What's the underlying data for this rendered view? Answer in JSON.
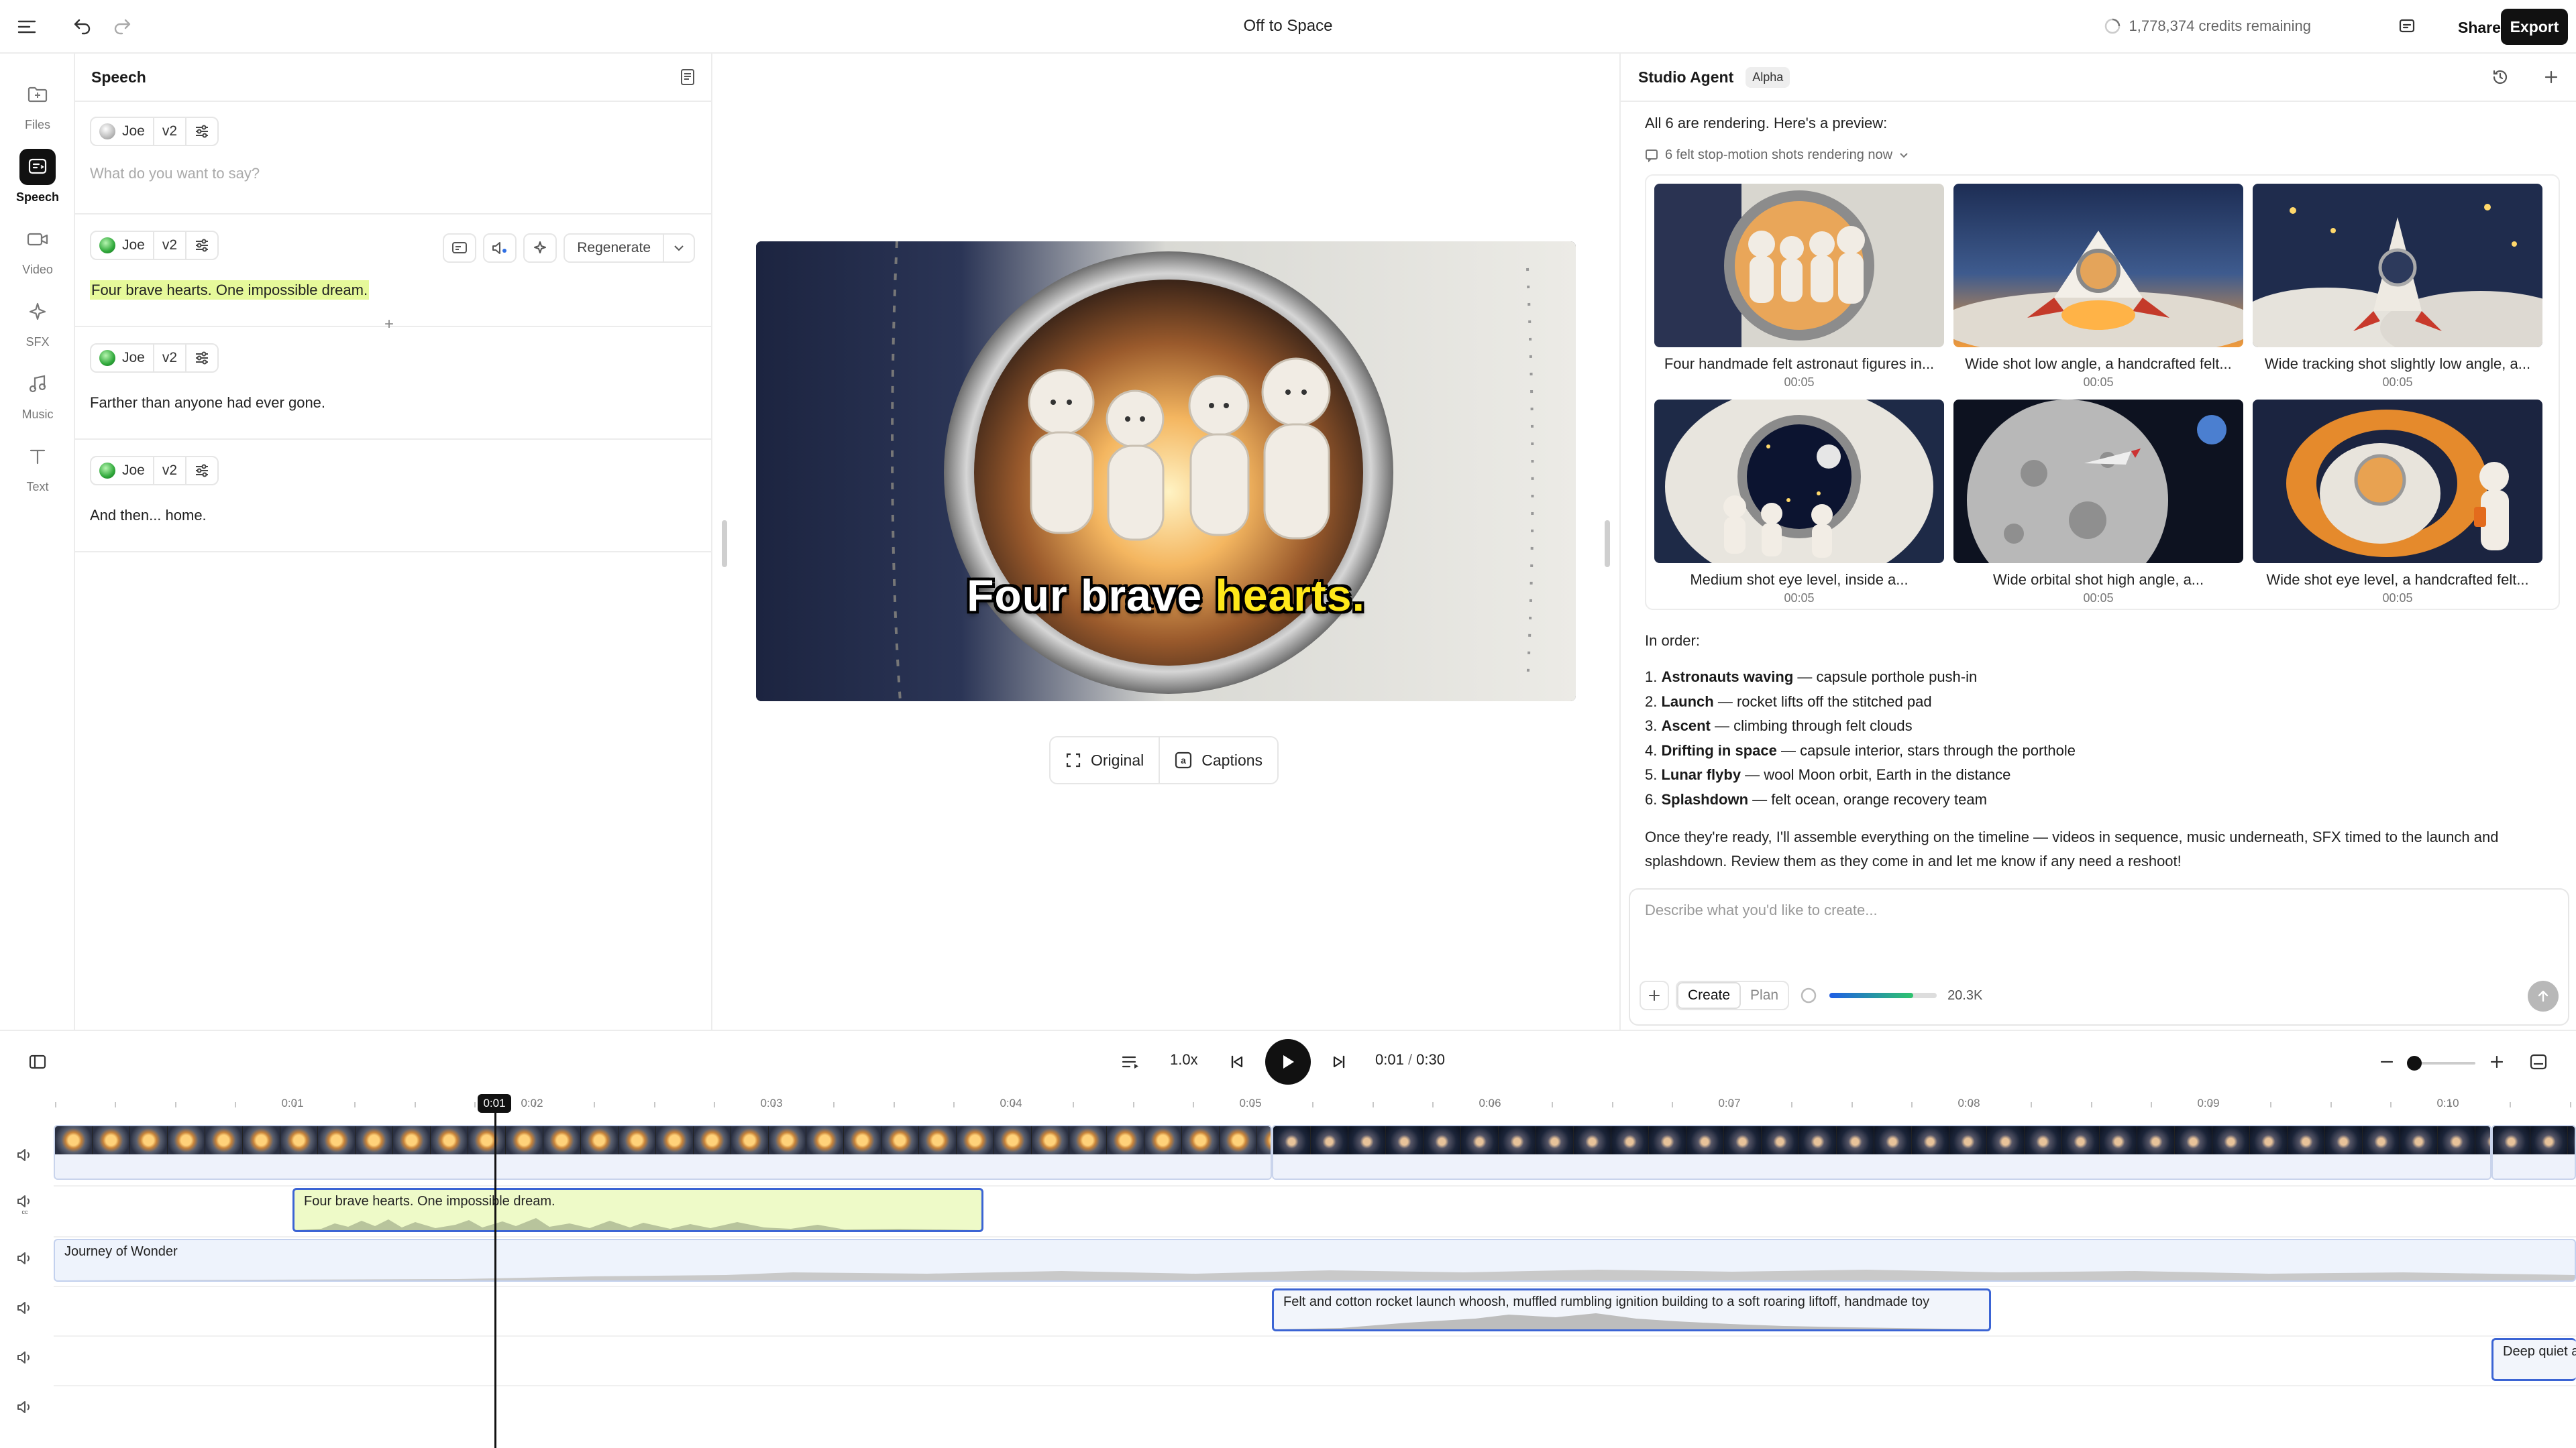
{
  "topbar": {
    "title": "Off to Space",
    "credits": "1,778,374 credits remaining",
    "share_label": "Share",
    "export_label": "Export"
  },
  "rail": {
    "items": [
      {
        "label": "Files",
        "icon": "folder-icon"
      },
      {
        "label": "Speech",
        "icon": "speech-icon",
        "active": true
      },
      {
        "label": "Video",
        "icon": "video-icon"
      },
      {
        "label": "SFX",
        "icon": "sfx-icon"
      },
      {
        "label": "Music",
        "icon": "music-icon"
      },
      {
        "label": "Text",
        "icon": "text-icon"
      }
    ]
  },
  "speech": {
    "title": "Speech",
    "segments": [
      {
        "voice": "Joe",
        "model": "v2",
        "text": "",
        "placeholder": "What do you want to say?"
      },
      {
        "voice": "Joe",
        "model": "v2",
        "text": "Four brave hearts. One impossible dream.",
        "regenerate_label": "Regenerate"
      },
      {
        "voice": "Joe",
        "model": "v2",
        "text": "Farther than anyone had ever gone."
      },
      {
        "voice": "Joe",
        "model": "v2",
        "text": "And then... home."
      }
    ]
  },
  "preview": {
    "caption_lead": "Four brave",
    "caption_highlight": "hearts.",
    "modes": [
      "Original",
      "Captions"
    ]
  },
  "agent": {
    "title": "Studio Agent",
    "badge": "Alpha",
    "intro": "All 6 are rendering. Here's a preview:",
    "status": "6 felt stop-motion shots rendering now",
    "shots": [
      {
        "title": "Four handmade felt astronaut figures in...",
        "duration": "00:05"
      },
      {
        "title": "Wide shot low angle, a handcrafted felt...",
        "duration": "00:05"
      },
      {
        "title": "Wide tracking shot slightly low angle, a...",
        "duration": "00:05"
      },
      {
        "title": "Medium shot eye level, inside a...",
        "duration": "00:05"
      },
      {
        "title": "Wide orbital shot high angle, a...",
        "duration": "00:05"
      },
      {
        "title": "Wide shot eye level, a handcrafted felt...",
        "duration": "00:05"
      }
    ],
    "order_heading": "In order:",
    "order": [
      {
        "num": "1.",
        "name": "Astronauts waving",
        "desc": " — capsule porthole push-in"
      },
      {
        "num": "2.",
        "name": "Launch",
        "desc": " — rocket lifts off the stitched pad"
      },
      {
        "num": "3.",
        "name": "Ascent",
        "desc": " — climbing through felt clouds"
      },
      {
        "num": "4.",
        "name": "Drifting in space",
        "desc": " — capsule interior, stars through the porthole"
      },
      {
        "num": "5.",
        "name": "Lunar flyby",
        "desc": " — wool Moon orbit, Earth in the distance"
      },
      {
        "num": "6.",
        "name": "Splashdown",
        "desc": " — felt ocean, orange recovery team"
      }
    ],
    "outro": "Once they're ready, I'll assemble everything on the timeline — videos in sequence, music underneath, SFX timed to the launch and splashdown. Review them as they come in and let me know if any need a reshoot!",
    "composer_placeholder": "Describe what you'd like to create...",
    "create_label": "Create",
    "plan_label": "Plan",
    "usage_label": "20.3K",
    "usage_fraction": 0.78
  },
  "transport": {
    "speed": "1.0x",
    "current": "0:01",
    "separator": " / ",
    "total": "0:30"
  },
  "timeline": {
    "ruler_labels": [
      "0:01",
      "0:02",
      "0:03",
      "0:04",
      "0:05",
      "0:06",
      "0:07",
      "0:08",
      "0:09",
      "0:10"
    ],
    "playhead_label": "0:01",
    "speech_clip": "Four brave hearts. One impossible dream.",
    "music_clip": "Journey of Wonder",
    "sfx_clip_1": "Felt and cotton rocket launch whoosh, muffled rumbling ignition building to a soft roaring liftoff, handmade toy",
    "sfx_clip_2": "Deep quiet a"
  },
  "colors": {
    "accent": "#3b64d4",
    "highlight": "#e6f99a",
    "caption_highlight": "#ffe81a"
  }
}
